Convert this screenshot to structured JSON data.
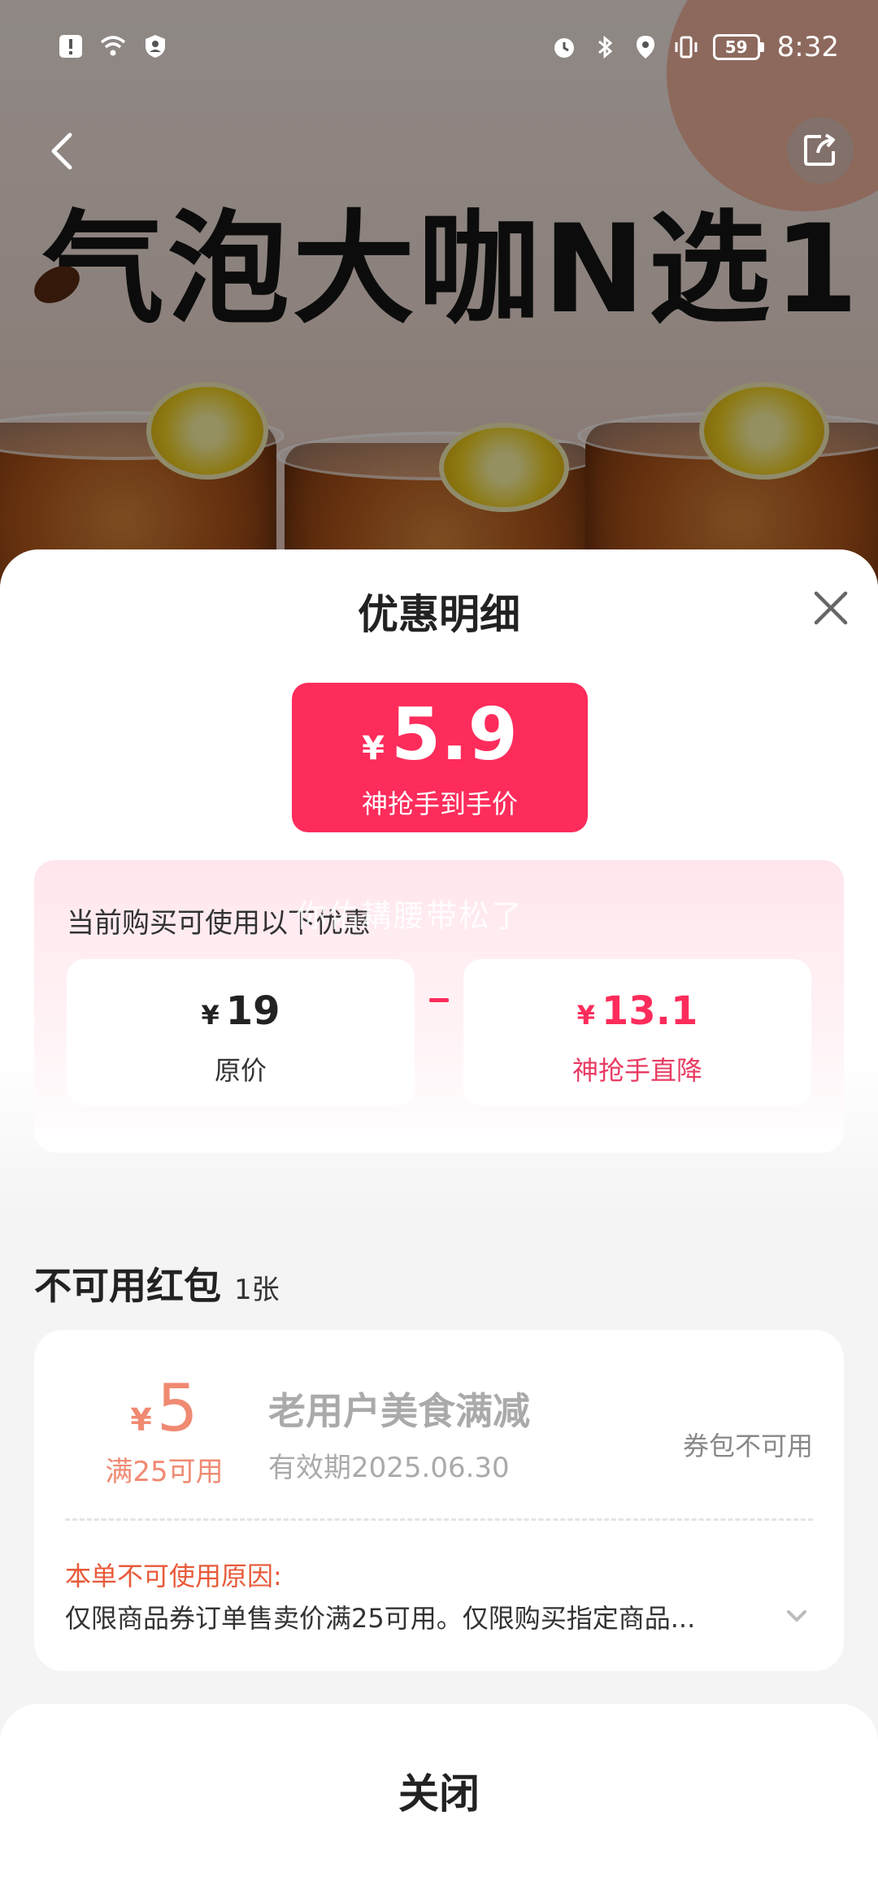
{
  "status_bar": {
    "time": "8:32",
    "battery": "59",
    "icons_left": [
      "alert-icon",
      "wifi-icon",
      "vpn-shield-icon"
    ],
    "icons_right": [
      "alarm-icon",
      "bluetooth-icon",
      "location-icon",
      "vibrate-icon"
    ]
  },
  "background": {
    "banner_title": "气泡大咖N选1"
  },
  "sheet": {
    "title": "优惠明细",
    "final_price": {
      "currency": "¥",
      "value": "5.9",
      "label": "神抢手到手价"
    },
    "discount_caption": "当前购买可使用以下优惠",
    "watermark": "你佑耩腰带松了",
    "original": {
      "currency": "¥",
      "value": "19",
      "label": "原价"
    },
    "reduction": {
      "currency": "¥",
      "value": "13.1",
      "label": "神抢手直降"
    }
  },
  "unavailable": {
    "title": "不可用红包",
    "count": "1张",
    "coupon": {
      "currency": "¥",
      "amount": "5",
      "condition": "满25可用",
      "name": "老用户美食满减",
      "expiry": "有效期2025.06.30",
      "status": "券包不可用",
      "reason_title": "本单不可使用原因:",
      "reason_text": "仅限商品券订单售卖价满25可用。仅限购买指定商品..."
    }
  },
  "footer": {
    "close_label": "关闭"
  },
  "colors": {
    "accent": "#fd2c5b",
    "coupon_orange": "#f08a72",
    "reason_red": "#e85a3a"
  }
}
